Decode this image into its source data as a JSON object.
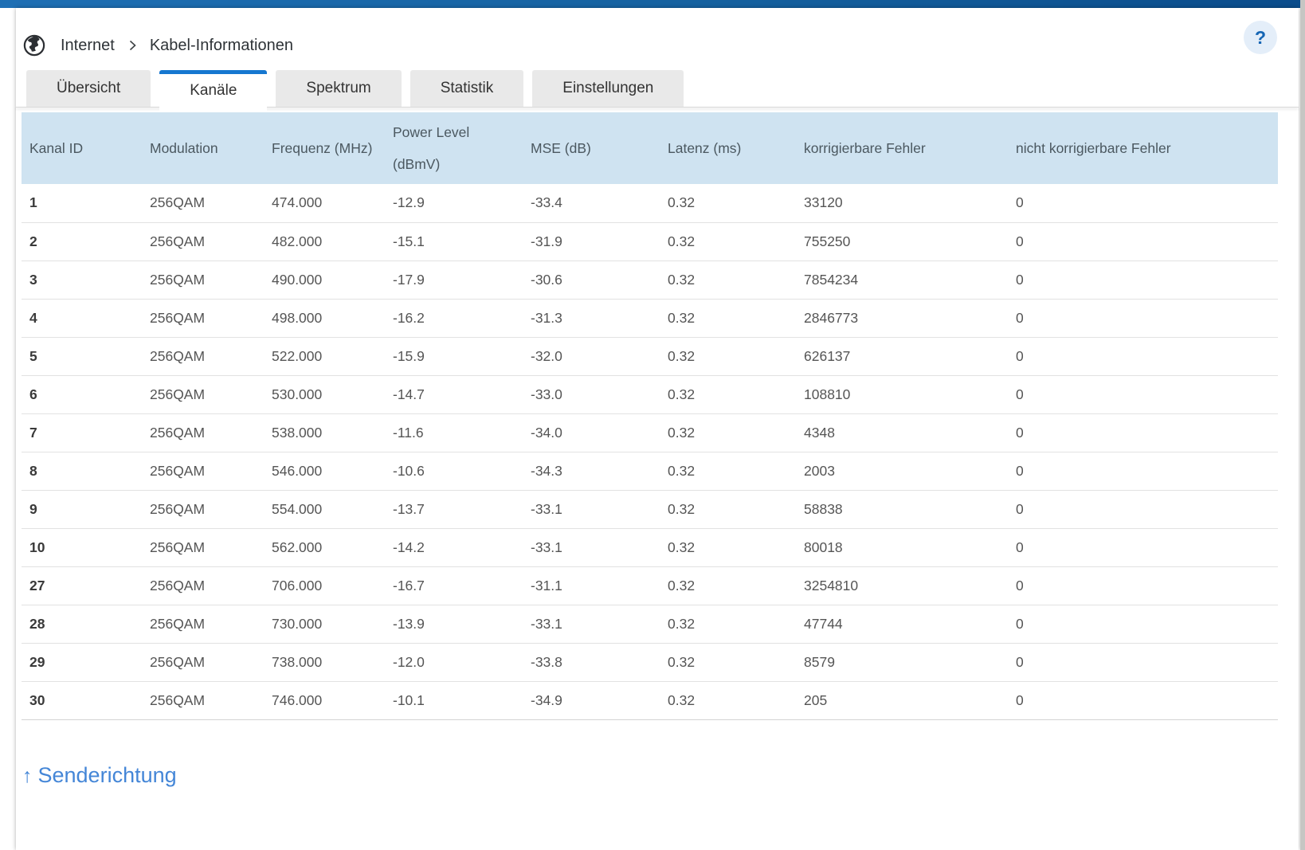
{
  "breadcrumb": {
    "icon": "globe",
    "section": "Internet",
    "separator": "chevron-right",
    "page": "Kabel-Informationen"
  },
  "help_button": {
    "label": "?"
  },
  "tabs": [
    {
      "label": "Übersicht",
      "active": false
    },
    {
      "label": "Kanäle",
      "active": true
    },
    {
      "label": "Spektrum",
      "active": false
    },
    {
      "label": "Statistik",
      "active": false
    },
    {
      "label": "Einstellungen",
      "active": false
    }
  ],
  "channel_table": {
    "columns": [
      "Kanal ID",
      "Modulation",
      "Frequenz (MHz)",
      "Power Level\n(dBmV)",
      "MSE (dB)",
      "Latenz (ms)",
      "korrigierbare Fehler",
      "nicht korrigierbare Fehler"
    ],
    "rows": [
      [
        "1",
        "256QAM",
        "474.000",
        "-12.9",
        "-33.4",
        "0.32",
        "33120",
        "0"
      ],
      [
        "2",
        "256QAM",
        "482.000",
        "-15.1",
        "-31.9",
        "0.32",
        "755250",
        "0"
      ],
      [
        "3",
        "256QAM",
        "490.000",
        "-17.9",
        "-30.6",
        "0.32",
        "7854234",
        "0"
      ],
      [
        "4",
        "256QAM",
        "498.000",
        "-16.2",
        "-31.3",
        "0.32",
        "2846773",
        "0"
      ],
      [
        "5",
        "256QAM",
        "522.000",
        "-15.9",
        "-32.0",
        "0.32",
        "626137",
        "0"
      ],
      [
        "6",
        "256QAM",
        "530.000",
        "-14.7",
        "-33.0",
        "0.32",
        "108810",
        "0"
      ],
      [
        "7",
        "256QAM",
        "538.000",
        "-11.6",
        "-34.0",
        "0.32",
        "4348",
        "0"
      ],
      [
        "8",
        "256QAM",
        "546.000",
        "-10.6",
        "-34.3",
        "0.32",
        "2003",
        "0"
      ],
      [
        "9",
        "256QAM",
        "554.000",
        "-13.7",
        "-33.1",
        "0.32",
        "58838",
        "0"
      ],
      [
        "10",
        "256QAM",
        "562.000",
        "-14.2",
        "-33.1",
        "0.32",
        "80018",
        "0"
      ],
      [
        "27",
        "256QAM",
        "706.000",
        "-16.7",
        "-31.1",
        "0.32",
        "3254810",
        "0"
      ],
      [
        "28",
        "256QAM",
        "730.000",
        "-13.9",
        "-33.1",
        "0.32",
        "47744",
        "0"
      ],
      [
        "29",
        "256QAM",
        "738.000",
        "-12.0",
        "-33.8",
        "0.32",
        "8579",
        "0"
      ],
      [
        "30",
        "256QAM",
        "746.000",
        "-10.1",
        "-34.9",
        "0.32",
        "205",
        "0"
      ]
    ]
  },
  "footer": {
    "arrow": "↑",
    "link_label": "Senderichtung"
  },
  "colors": {
    "accent_blue": "#1577d0",
    "topbar_gradient_start": "#1e6fb4",
    "topbar_gradient_end": "#0a4c8b",
    "table_header_bg": "#cfe3f1",
    "link_blue": "#4486d7",
    "help_circle_bg": "#e4eef9",
    "tab_inactive_bg": "#e9e9e9"
  }
}
